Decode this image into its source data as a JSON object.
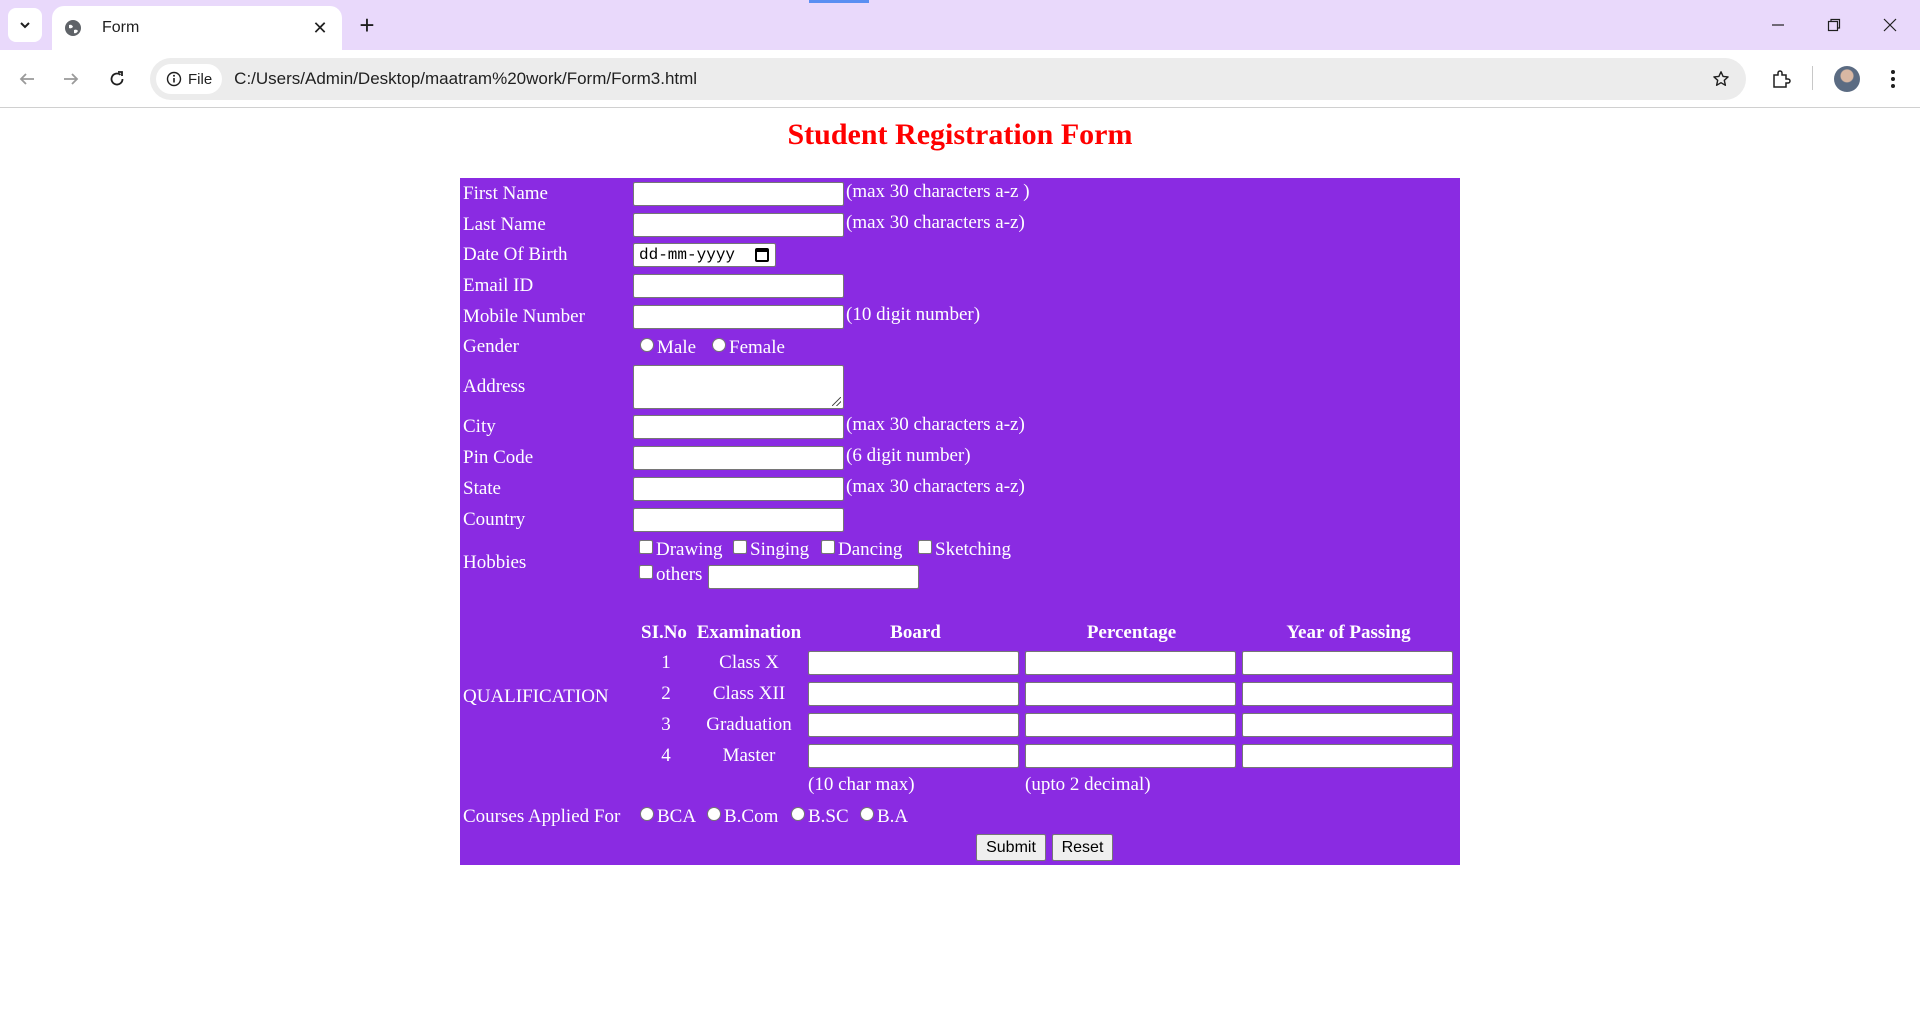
{
  "browser": {
    "tab_title": "Form",
    "new_tab_label": "+",
    "tab_close_label": "✕",
    "chip_label": "File",
    "url": "C:/Users/Admin/Desktop/maatram%20work/Form/Form3.html",
    "icons": [
      "tab-search-icon",
      "globe-icon",
      "close-icon",
      "new-tab-icon",
      "minimize-icon",
      "restore-icon",
      "window-close-icon",
      "back-icon",
      "forward-icon",
      "reload-icon",
      "info-icon",
      "star-icon",
      "extensions-icon",
      "avatar",
      "menu-icon"
    ]
  },
  "form": {
    "title": "Student Registration Form",
    "panel_color": "#8a2be2",
    "title_color": "#ff0000",
    "fields": {
      "first_name": {
        "label": "First Name",
        "note": "(max 30 characters a-z )",
        "value": ""
      },
      "last_name": {
        "label": "Last Name",
        "note": "(max 30 characters a-z)",
        "value": ""
      },
      "dob": {
        "label": "Date Of Birth",
        "placeholder": "dd-mm-yyyy"
      },
      "email": {
        "label": "Email ID",
        "value": ""
      },
      "mobile": {
        "label": "Mobile Number",
        "note": "(10 digit number)",
        "value": ""
      },
      "gender": {
        "label": "Gender",
        "options": [
          "Male",
          "Female"
        ]
      },
      "address": {
        "label": "Address",
        "value": ""
      },
      "city": {
        "label": "City",
        "note": "(max 30 characters a-z)",
        "value": ""
      },
      "pincode": {
        "label": "Pin Code",
        "note": "(6 digit number)",
        "value": ""
      },
      "state": {
        "label": "State",
        "note": "(max 30 characters a-z)",
        "value": ""
      },
      "country": {
        "label": "Country",
        "value": ""
      },
      "hobbies": {
        "label": "Hobbies",
        "options": [
          "Drawing",
          "Singing",
          "Dancing",
          "Sketching",
          "others"
        ]
      }
    },
    "qualification": {
      "label": "QUALIFICATION",
      "headers": [
        "SI.No",
        "Examination",
        "Board",
        "Percentage",
        "Year of Passing"
      ],
      "rows": [
        {
          "no": "1",
          "exam": "Class X"
        },
        {
          "no": "2",
          "exam": "Class XII"
        },
        {
          "no": "3",
          "exam": "Graduation"
        },
        {
          "no": "4",
          "exam": "Master"
        }
      ],
      "notes": [
        "(10 char max)",
        "(upto 2 decimal)"
      ]
    },
    "courses": {
      "label": "Courses Applied For",
      "options": [
        "BCA",
        "B.Com",
        "B.SC",
        "B.A"
      ]
    },
    "buttons": {
      "submit": "Submit",
      "reset": "Reset"
    }
  }
}
